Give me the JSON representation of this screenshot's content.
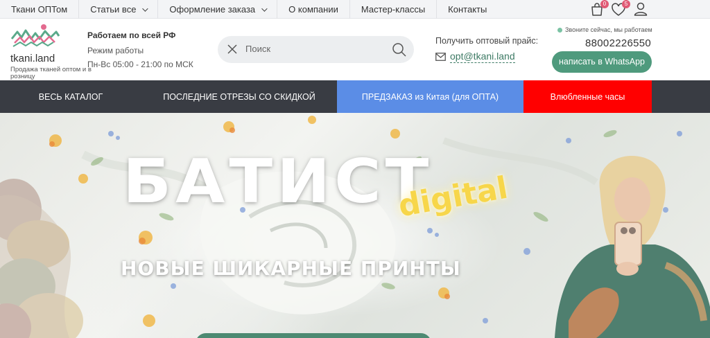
{
  "topnav": {
    "items": [
      {
        "label": "Ткани ОПТом",
        "dropdown": false
      },
      {
        "label": "Статьи все",
        "dropdown": true
      },
      {
        "label": "Оформление заказа",
        "dropdown": true
      },
      {
        "label": "О компании",
        "dropdown": false
      },
      {
        "label": "Мастер-классы",
        "dropdown": false
      },
      {
        "label": "Контакты",
        "dropdown": false
      }
    ],
    "cart_count": "0",
    "favorites_count": "5",
    "icons": [
      "cart-icon",
      "heart-icon",
      "user-icon"
    ]
  },
  "header": {
    "logo_title": "tkani.land",
    "logo_subtitle": "Продажа тканей оптом и в розницу",
    "work_region": "Работаем по всей РФ",
    "work_mode_label": "Режим работы",
    "work_hours": "Пн-Вс 05:00 - 21:00 по МСК",
    "search_placeholder": "Поиск",
    "price_label": "Получить оптовый прайс:",
    "price_email": "opt@tkani.land",
    "call_status": "Звоните сейчас, мы работаем",
    "phone": "88002226550",
    "whatsapp_button": "написать в WhatsApp"
  },
  "catnav": {
    "items": [
      {
        "label": "ВЕСЬ КАТАЛОГ"
      },
      {
        "label": "ПОСЛЕДНИЕ ОТРЕЗЫ СО СКИДКОЙ"
      },
      {
        "label": "ПРЕДЗАКАЗ из Китая (для ОПТА)"
      },
      {
        "label": "Влюбленные часы"
      }
    ]
  },
  "banner": {
    "title": "БАТИСТ",
    "accent": "digital",
    "subtitle": "НОВЫЕ ШИКАРНЫЕ ПРИНТЫ"
  },
  "colors": {
    "topbar_bg": "#f3f4f6",
    "catnav_bg": "#393c43",
    "preorder_bg": "#5b8de6",
    "love_hours_bg": "#ff0000",
    "brand_green": "#4f9a7d",
    "badge": "#e05a75"
  }
}
